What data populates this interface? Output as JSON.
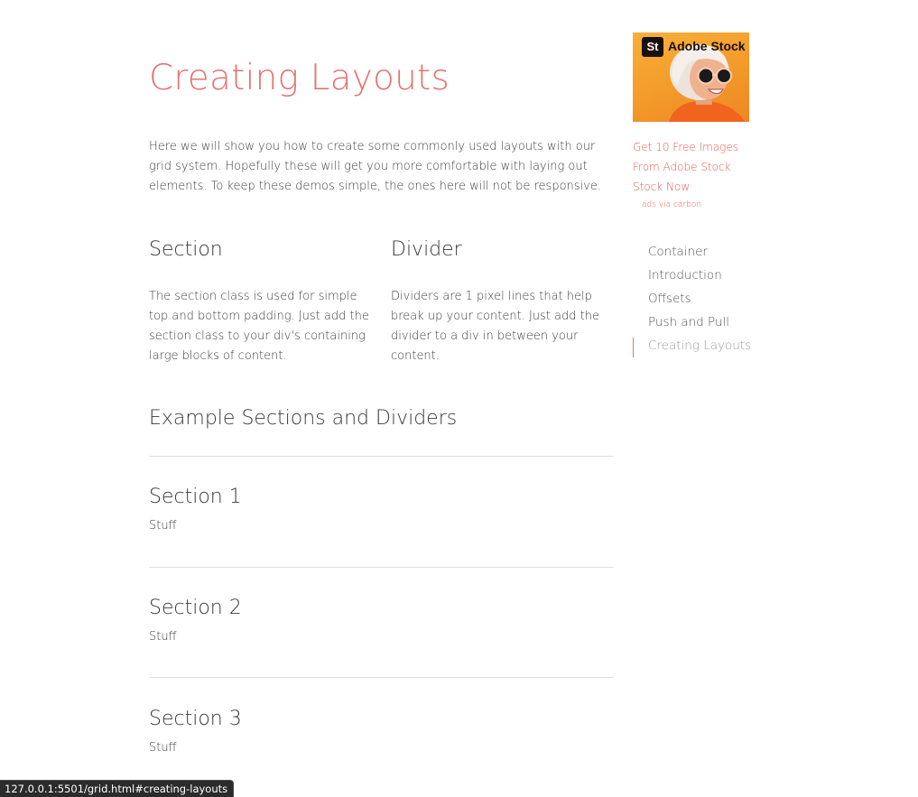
{
  "main": {
    "title": "Creating Layouts",
    "intro": "Here we will show you how to create some commonly used layouts with our grid system. Hopefully these will get you more comfortable with laying out elements. To keep these demos simple, the ones here will not be responsive.",
    "columns": [
      {
        "heading": "Section",
        "text": "The section class is used for simple top and bottom padding. Just add the section class to your div's containing large blocks of content."
      },
      {
        "heading": "Divider",
        "text": "Dividers are 1 pixel lines that help break up your content. Just add the divider to a div in between your content."
      }
    ],
    "example_title": "Example Sections and Dividers",
    "sections": [
      {
        "heading": "Section 1",
        "text": "Stuff"
      },
      {
        "heading": "Section 2",
        "text": "Stuff"
      },
      {
        "heading": "Section 3",
        "text": "Stuff"
      }
    ]
  },
  "sidebar": {
    "ad": {
      "logo_text": "St",
      "brand": "Adobe Stock",
      "text": "Get 10 Free Images From Adobe Stock Stock Now",
      "via": "ads via carbon"
    },
    "toc": [
      {
        "label": "Container",
        "active": false
      },
      {
        "label": "Introduction",
        "active": false
      },
      {
        "label": "Offsets",
        "active": false
      },
      {
        "label": "Push and Pull",
        "active": false
      },
      {
        "label": "Creating Layouts",
        "active": true
      }
    ]
  },
  "status_bar": {
    "url": "127.0.0.1:5501/grid.html#creating-layouts"
  },
  "colors": {
    "accent": "#e57373",
    "ad_link": "#e55b4d",
    "ad_background": "#f7a832",
    "divider": "#e0e0e0"
  }
}
